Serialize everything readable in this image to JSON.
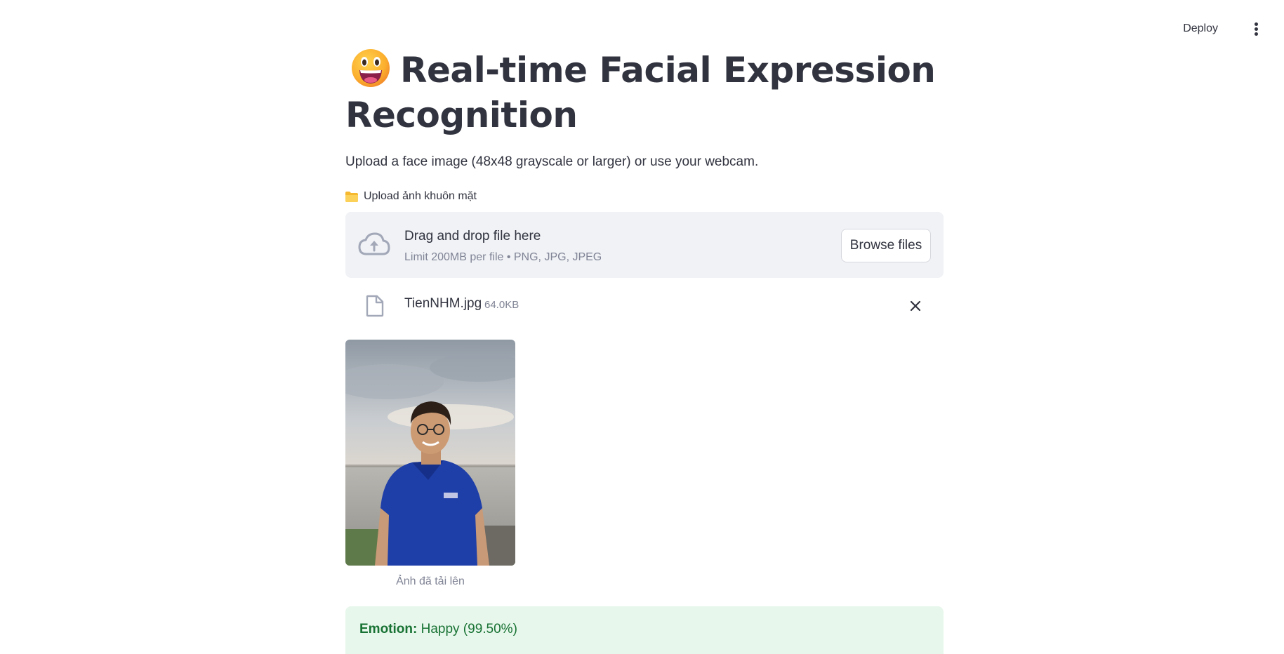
{
  "header": {
    "deploy_label": "Deploy",
    "menu_icon": "vertical-ellipsis-icon"
  },
  "main": {
    "title": "Real-time Facial Expression Recognition",
    "title_icon": "grinning-face-emoji-icon",
    "subtitle": "Upload a face image (48x48 grayscale or larger) or use your webcam.",
    "upload_label": "Upload ảnh khuôn mặt",
    "upload_label_icon": "folder-icon"
  },
  "dropzone": {
    "icon": "cloud-upload-icon",
    "title": "Drag and drop file here",
    "limit": "Limit 200MB per file • PNG, JPG, JPEG",
    "browse_label": "Browse files"
  },
  "uploaded_file": {
    "icon": "file-icon",
    "name": "TienNHM.jpg",
    "size": "64.0KB",
    "remove_icon": "close-icon"
  },
  "image": {
    "caption": "Ảnh đã tải lên"
  },
  "result": {
    "label": "Emotion:",
    "value": "Happy (99.50%)"
  },
  "colors": {
    "text": "#31333f",
    "muted": "#808495",
    "dropzone_bg": "#f0f2f6",
    "success_bg": "#e8f7ec",
    "success_text": "#177233"
  }
}
